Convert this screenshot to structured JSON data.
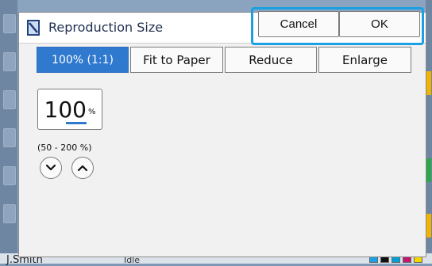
{
  "dialog": {
    "title": "Reproduction Size",
    "icon": "document-icon",
    "actions": {
      "cancel_label": "Cancel",
      "ok_label": "OK"
    }
  },
  "modes": {
    "selected": "100% (1:1)",
    "items": [
      {
        "label": "100% (1:1)",
        "active": true
      },
      {
        "label": "Fit to Paper",
        "active": false
      },
      {
        "label": "Reduce",
        "active": false
      },
      {
        "label": "Enlarge",
        "active": false
      }
    ]
  },
  "size": {
    "value": "100",
    "unit": "%",
    "range": "(50 - 200 %)"
  },
  "background": {
    "user": "J.Smith",
    "status": "Idle"
  },
  "colors": {
    "accent": "#2f79cf",
    "highlight_frame": "#1aa0e3",
    "ink_colors": [
      "#1aa0e3",
      "#111111",
      "#00a0d6",
      "#c2186b",
      "#f2d600"
    ]
  }
}
